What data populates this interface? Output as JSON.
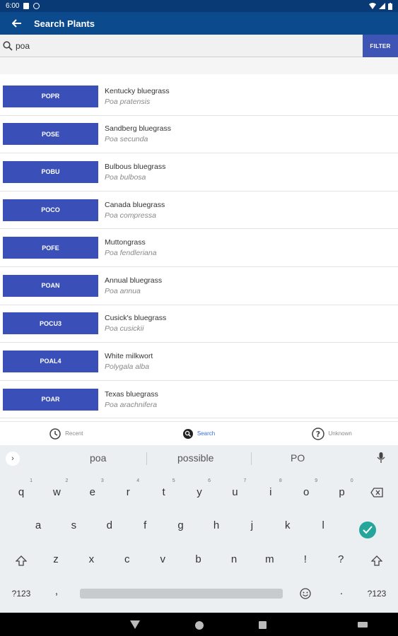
{
  "status_bar": {
    "time": "6:00"
  },
  "app_bar": {
    "title": "Search Plants"
  },
  "search": {
    "value": "poa",
    "filter_label": "FILTER"
  },
  "plants": [
    {
      "code": "POPR",
      "common": "Kentucky bluegrass",
      "scientific": "Poa pratensis"
    },
    {
      "code": "POSE",
      "common": "Sandberg bluegrass",
      "scientific": "Poa secunda"
    },
    {
      "code": "POBU",
      "common": "Bulbous bluegrass",
      "scientific": "Poa bulbosa"
    },
    {
      "code": "POCO",
      "common": "Canada bluegrass",
      "scientific": "Poa compressa"
    },
    {
      "code": "POFE",
      "common": "Muttongrass",
      "scientific": "Poa fendleriana"
    },
    {
      "code": "POAN",
      "common": "Annual bluegrass",
      "scientific": "Poa annua"
    },
    {
      "code": "POCU3",
      "common": "Cusick's bluegrass",
      "scientific": "Poa cusickii"
    },
    {
      "code": "POAL4",
      "common": "White milkwort",
      "scientific": "Polygala alba"
    },
    {
      "code": "POAR",
      "common": "Texas bluegrass",
      "scientific": "Poa arachnifera"
    }
  ],
  "bottom_nav": [
    {
      "label": "Recent",
      "icon": "clock-icon"
    },
    {
      "label": "Search",
      "icon": "search-icon",
      "active": true
    },
    {
      "label": "Unknown",
      "icon": "question-icon"
    }
  ],
  "keyboard": {
    "suggestions": [
      "poa",
      "possible",
      "PO"
    ],
    "row1": [
      "q",
      "w",
      "e",
      "r",
      "t",
      "y",
      "u",
      "i",
      "o",
      "p"
    ],
    "row1_hints": [
      "1",
      "2",
      "3",
      "4",
      "5",
      "6",
      "7",
      "8",
      "9",
      "0"
    ],
    "row2": [
      "a",
      "s",
      "d",
      "f",
      "g",
      "h",
      "j",
      "k",
      "l"
    ],
    "row3": [
      "z",
      "x",
      "c",
      "v",
      "b",
      "n",
      "m",
      "!",
      "?"
    ],
    "symbols_label": "?123",
    "comma": ",",
    "period": "."
  },
  "colors": {
    "app_bar": "#0c4a8e",
    "status_bar": "#0a3a75",
    "badge": "#3a4fb8",
    "accent": "#3a6fd8",
    "enter": "#26a69a"
  }
}
